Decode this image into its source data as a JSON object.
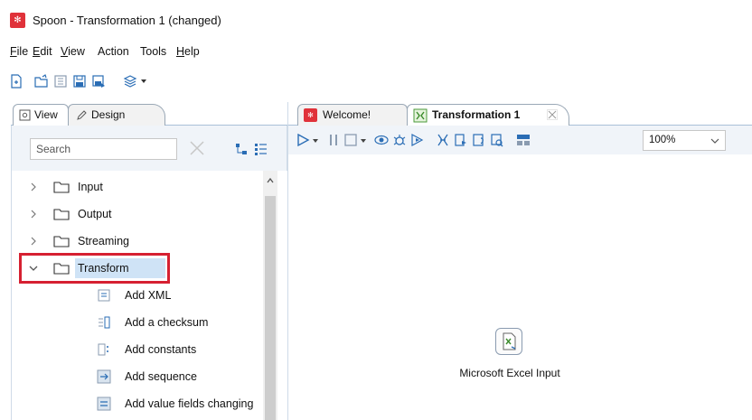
{
  "window": {
    "title": "Spoon - Transformation 1 (changed)",
    "logo": "spoon-logo-icon"
  },
  "menu": [
    {
      "underline": "F",
      "rest": "ile"
    },
    {
      "underline": "E",
      "rest": "dit"
    },
    {
      "underline": "V",
      "rest": "iew"
    },
    {
      "underline": "",
      "rest": "Action"
    },
    {
      "underline": "",
      "rest": "Tools"
    },
    {
      "underline": "H",
      "rest": "elp"
    }
  ],
  "left_tabs": {
    "view": "View",
    "design": "Design"
  },
  "search": {
    "placeholder": "Search",
    "value": ""
  },
  "tree": {
    "folders": [
      "Input",
      "Output",
      "Streaming",
      "Transform"
    ],
    "transform_children": [
      "Add XML",
      "Add a checksum",
      "Add constants",
      "Add sequence",
      "Add value fields changing"
    ]
  },
  "right_tabs": {
    "welcome": "Welcome!",
    "transformation": "Transformation 1"
  },
  "zoom": {
    "value": "100%"
  },
  "canvas": {
    "step_label": "Microsoft Excel Input"
  },
  "colors": {
    "accent_blue": "#2a6db5",
    "selection_red": "#d62031",
    "highlight": "#cfe3f6",
    "brand_red": "#e0323a"
  }
}
